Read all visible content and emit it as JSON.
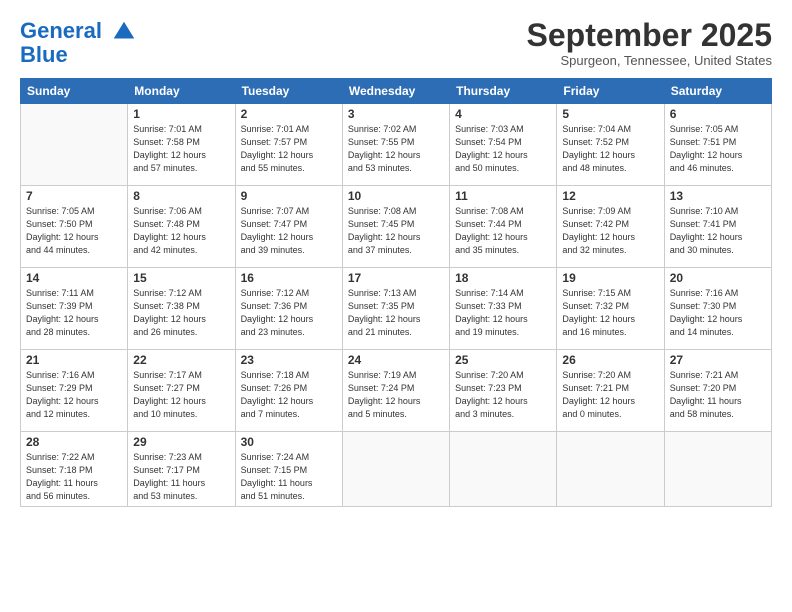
{
  "logo": {
    "line1": "General",
    "line2": "Blue"
  },
  "title": "September 2025",
  "subtitle": "Spurgeon, Tennessee, United States",
  "weekdays": [
    "Sunday",
    "Monday",
    "Tuesday",
    "Wednesday",
    "Thursday",
    "Friday",
    "Saturday"
  ],
  "weeks": [
    [
      {
        "num": "",
        "info": ""
      },
      {
        "num": "1",
        "info": "Sunrise: 7:01 AM\nSunset: 7:58 PM\nDaylight: 12 hours\nand 57 minutes."
      },
      {
        "num": "2",
        "info": "Sunrise: 7:01 AM\nSunset: 7:57 PM\nDaylight: 12 hours\nand 55 minutes."
      },
      {
        "num": "3",
        "info": "Sunrise: 7:02 AM\nSunset: 7:55 PM\nDaylight: 12 hours\nand 53 minutes."
      },
      {
        "num": "4",
        "info": "Sunrise: 7:03 AM\nSunset: 7:54 PM\nDaylight: 12 hours\nand 50 minutes."
      },
      {
        "num": "5",
        "info": "Sunrise: 7:04 AM\nSunset: 7:52 PM\nDaylight: 12 hours\nand 48 minutes."
      },
      {
        "num": "6",
        "info": "Sunrise: 7:05 AM\nSunset: 7:51 PM\nDaylight: 12 hours\nand 46 minutes."
      }
    ],
    [
      {
        "num": "7",
        "info": "Sunrise: 7:05 AM\nSunset: 7:50 PM\nDaylight: 12 hours\nand 44 minutes."
      },
      {
        "num": "8",
        "info": "Sunrise: 7:06 AM\nSunset: 7:48 PM\nDaylight: 12 hours\nand 42 minutes."
      },
      {
        "num": "9",
        "info": "Sunrise: 7:07 AM\nSunset: 7:47 PM\nDaylight: 12 hours\nand 39 minutes."
      },
      {
        "num": "10",
        "info": "Sunrise: 7:08 AM\nSunset: 7:45 PM\nDaylight: 12 hours\nand 37 minutes."
      },
      {
        "num": "11",
        "info": "Sunrise: 7:08 AM\nSunset: 7:44 PM\nDaylight: 12 hours\nand 35 minutes."
      },
      {
        "num": "12",
        "info": "Sunrise: 7:09 AM\nSunset: 7:42 PM\nDaylight: 12 hours\nand 32 minutes."
      },
      {
        "num": "13",
        "info": "Sunrise: 7:10 AM\nSunset: 7:41 PM\nDaylight: 12 hours\nand 30 minutes."
      }
    ],
    [
      {
        "num": "14",
        "info": "Sunrise: 7:11 AM\nSunset: 7:39 PM\nDaylight: 12 hours\nand 28 minutes."
      },
      {
        "num": "15",
        "info": "Sunrise: 7:12 AM\nSunset: 7:38 PM\nDaylight: 12 hours\nand 26 minutes."
      },
      {
        "num": "16",
        "info": "Sunrise: 7:12 AM\nSunset: 7:36 PM\nDaylight: 12 hours\nand 23 minutes."
      },
      {
        "num": "17",
        "info": "Sunrise: 7:13 AM\nSunset: 7:35 PM\nDaylight: 12 hours\nand 21 minutes."
      },
      {
        "num": "18",
        "info": "Sunrise: 7:14 AM\nSunset: 7:33 PM\nDaylight: 12 hours\nand 19 minutes."
      },
      {
        "num": "19",
        "info": "Sunrise: 7:15 AM\nSunset: 7:32 PM\nDaylight: 12 hours\nand 16 minutes."
      },
      {
        "num": "20",
        "info": "Sunrise: 7:16 AM\nSunset: 7:30 PM\nDaylight: 12 hours\nand 14 minutes."
      }
    ],
    [
      {
        "num": "21",
        "info": "Sunrise: 7:16 AM\nSunset: 7:29 PM\nDaylight: 12 hours\nand 12 minutes."
      },
      {
        "num": "22",
        "info": "Sunrise: 7:17 AM\nSunset: 7:27 PM\nDaylight: 12 hours\nand 10 minutes."
      },
      {
        "num": "23",
        "info": "Sunrise: 7:18 AM\nSunset: 7:26 PM\nDaylight: 12 hours\nand 7 minutes."
      },
      {
        "num": "24",
        "info": "Sunrise: 7:19 AM\nSunset: 7:24 PM\nDaylight: 12 hours\nand 5 minutes."
      },
      {
        "num": "25",
        "info": "Sunrise: 7:20 AM\nSunset: 7:23 PM\nDaylight: 12 hours\nand 3 minutes."
      },
      {
        "num": "26",
        "info": "Sunrise: 7:20 AM\nSunset: 7:21 PM\nDaylight: 12 hours\nand 0 minutes."
      },
      {
        "num": "27",
        "info": "Sunrise: 7:21 AM\nSunset: 7:20 PM\nDaylight: 11 hours\nand 58 minutes."
      }
    ],
    [
      {
        "num": "28",
        "info": "Sunrise: 7:22 AM\nSunset: 7:18 PM\nDaylight: 11 hours\nand 56 minutes."
      },
      {
        "num": "29",
        "info": "Sunrise: 7:23 AM\nSunset: 7:17 PM\nDaylight: 11 hours\nand 53 minutes."
      },
      {
        "num": "30",
        "info": "Sunrise: 7:24 AM\nSunset: 7:15 PM\nDaylight: 11 hours\nand 51 minutes."
      },
      {
        "num": "",
        "info": ""
      },
      {
        "num": "",
        "info": ""
      },
      {
        "num": "",
        "info": ""
      },
      {
        "num": "",
        "info": ""
      }
    ]
  ]
}
